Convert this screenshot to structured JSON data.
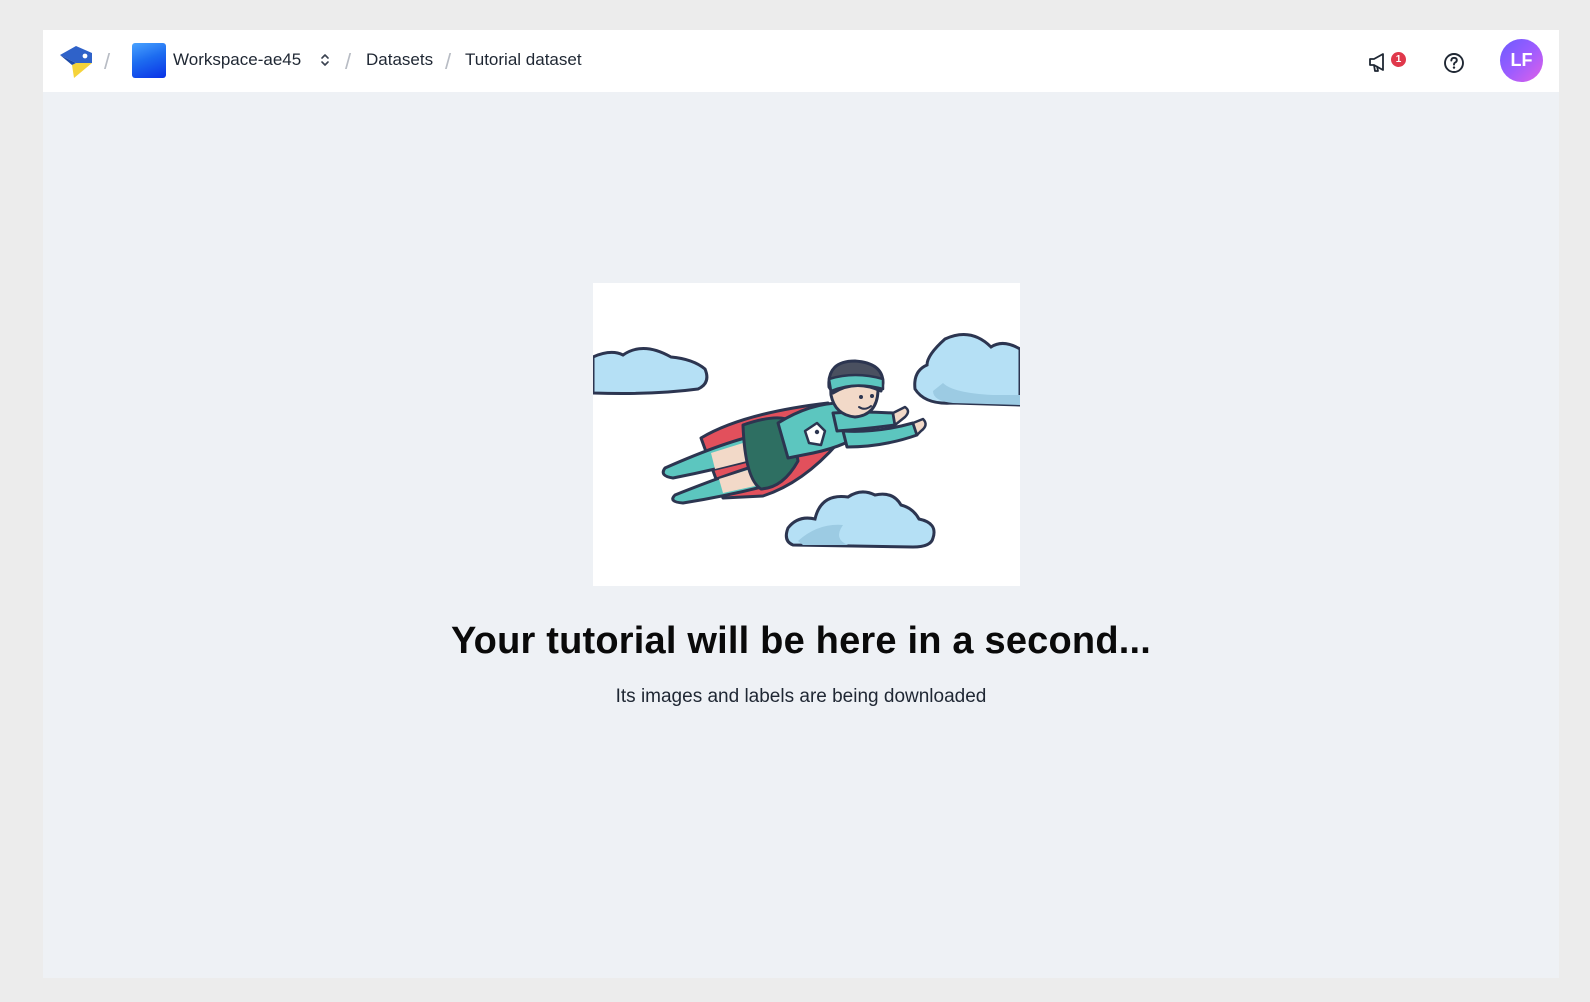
{
  "header": {
    "workspace_name": "Workspace-ae45",
    "breadcrumb_datasets": "Datasets",
    "breadcrumb_current": "Tutorial dataset",
    "notification_count": "1",
    "user_initials": "LF"
  },
  "main": {
    "headline": "Your tutorial will be here in a second...",
    "subline": "Its images and labels are being downloaded"
  },
  "colors": {
    "accent_blue": "#1d6cf0",
    "badge_red": "#e0384b",
    "avatar_gradient_start": "#6b5bff",
    "avatar_gradient_end": "#e061e8",
    "page_bg": "#eef1f5"
  },
  "icons": [
    "app-logo-icon",
    "chevron-updown-icon",
    "megaphone-icon",
    "help-icon"
  ]
}
